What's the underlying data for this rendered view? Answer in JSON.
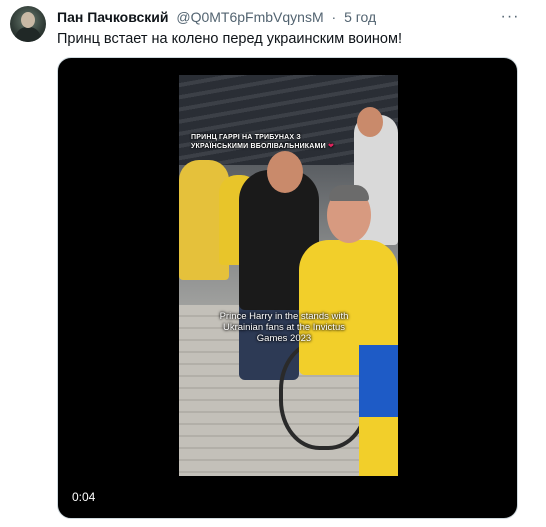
{
  "tweet": {
    "author_name": "Пан Пачковский",
    "handle": "@Q0MT6pFmbVqynsM",
    "separator": "·",
    "time": "5 год",
    "more_label": "···",
    "text": "Принц встает на колено перед украинским воином!"
  },
  "video": {
    "caption_ua": "ПРИНЦ ГАРРІ НА ТРИБУНАХ З УКРАЇНСЬКИМИ ВБОЛІВАЛЬНИКАМИ",
    "caption_ua_heart": "❤",
    "caption_en": "Prince Harry in the stands with Ukrainian fans at the Invictus Games 2023",
    "time": "0:04"
  }
}
